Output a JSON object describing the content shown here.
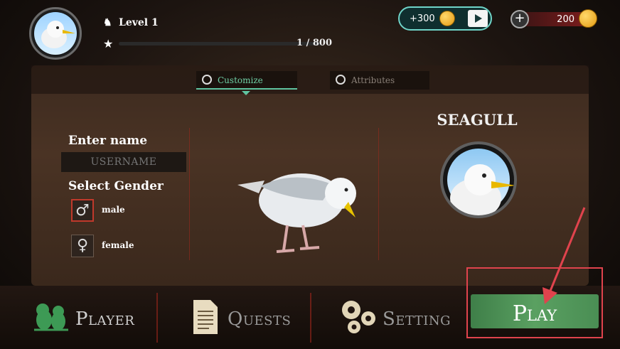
{
  "profile": {
    "level_label": "Level 1",
    "xp_text": "1 / 800"
  },
  "rewards": {
    "video_bonus": "+300",
    "coins": "200"
  },
  "tabs": [
    {
      "label": "Customize",
      "active": true
    },
    {
      "label": "Attributes",
      "active": false
    }
  ],
  "form": {
    "enter_name_label": "Enter name",
    "name_placeholder": "USERNAME",
    "select_gender_label": "Select Gender",
    "genders": [
      {
        "label": "male",
        "selected": true,
        "symbol": "♂"
      },
      {
        "label": "female",
        "selected": false,
        "symbol": "♀"
      }
    ]
  },
  "species": {
    "name": "SEAGULL"
  },
  "nav": {
    "player": "Player",
    "quests": "Quests",
    "setting": "Setting",
    "play": "Play"
  },
  "icons": [
    "knight-icon",
    "star-icon",
    "coin-icon",
    "tv-play-icon",
    "plus-icon",
    "compass-icon",
    "birds-icon",
    "document-icon",
    "gears-icon"
  ],
  "colors": {
    "accent_teal": "#6fd4c8",
    "play_green": "#4a8e54",
    "highlight_red": "#e0434d"
  }
}
